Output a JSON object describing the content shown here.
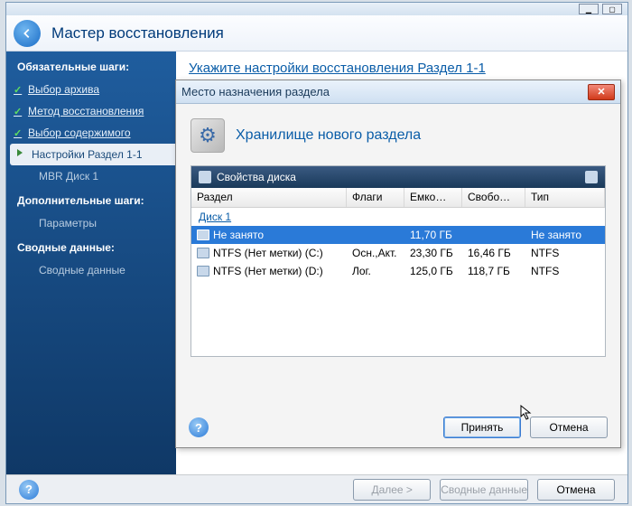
{
  "outer": {
    "wizard_title": "Мастер восстановления",
    "main_heading": "Укажите настройки восстановления Раздел 1-1",
    "footer": {
      "next": "Далее >",
      "summary": "Сводные данные",
      "cancel": "Отмена"
    }
  },
  "sidebar": {
    "required_heading": "Обязательные шаги:",
    "additional_heading": "Дополнительные шаги:",
    "summary_heading": "Сводные данные:",
    "items": {
      "archive": "Выбор архива",
      "method": "Метод восстановления",
      "content": "Выбор содержимого",
      "settings": "Настройки Раздел 1-1",
      "mbr": "MBR Диск 1",
      "params": "Параметры",
      "summary": "Сводные данные"
    }
  },
  "dialog": {
    "title": "Место назначения раздела",
    "heading": "Хранилище нового раздела",
    "panel_title": "Свойства диска",
    "columns": {
      "part": "Раздел",
      "flags": "Флаги",
      "cap": "Емко…",
      "free": "Свобо…",
      "type": "Тип"
    },
    "disk_label": "Диск 1",
    "rows": [
      {
        "part": "Не занято",
        "flags": "",
        "cap": "11,70 ГБ",
        "free": "",
        "type": "Не занято",
        "selected": true
      },
      {
        "part": "NTFS (Нет метки) (C:)",
        "flags": "Осн.,Акт.",
        "cap": "23,30 ГБ",
        "free": "16,46 ГБ",
        "type": "NTFS",
        "selected": false
      },
      {
        "part": "NTFS (Нет метки) (D:)",
        "flags": "Лог.",
        "cap": "125,0 ГБ",
        "free": "118,7 ГБ",
        "type": "NTFS",
        "selected": false
      }
    ],
    "accept": "Принять",
    "cancel": "Отмена"
  }
}
